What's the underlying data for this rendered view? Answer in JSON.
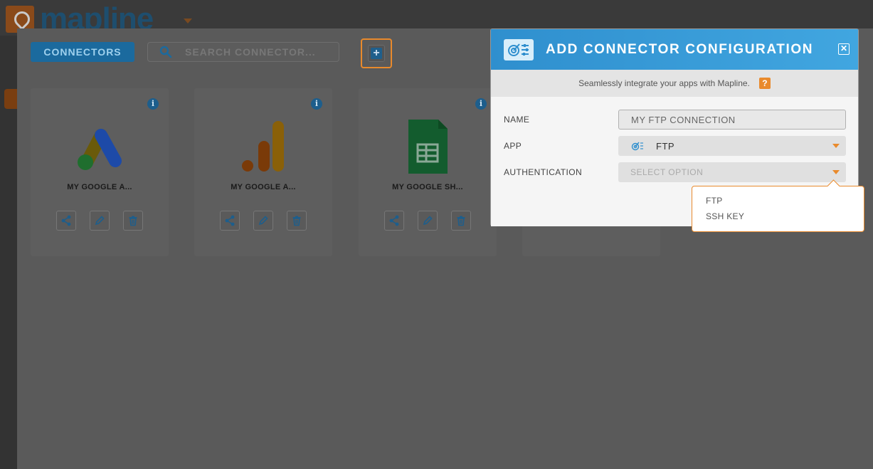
{
  "app": {
    "logo_text": "mapline"
  },
  "toolbar": {
    "connectors_label": "CONNECTORS",
    "search_placeholder": "SEARCH CONNECTOR..."
  },
  "cards": [
    {
      "name": "MY GOOGLE A...",
      "logo": "google-ads-icon"
    },
    {
      "name": "MY GOOGLE A...",
      "logo": "google-analytics-icon"
    },
    {
      "name": "MY GOOGLE SH...",
      "logo": "google-sheets-icon"
    }
  ],
  "dialog": {
    "title": "ADD CONNECTOR CONFIGURATION",
    "subtitle": "Seamlessly integrate your apps with Mapline.",
    "help_label": "?",
    "close_label": "✕",
    "fields": {
      "name_label": "NAME",
      "name_value": "MY FTP CONNECTION",
      "app_label": "APP",
      "app_value": "FTP",
      "auth_label": "AUTHENTICATION",
      "auth_placeholder": "SELECT OPTION"
    },
    "auth_options": [
      "FTP",
      "SSH KEY"
    ]
  },
  "colors": {
    "accent": "#e98a2c",
    "primary": "#2f8fce"
  }
}
